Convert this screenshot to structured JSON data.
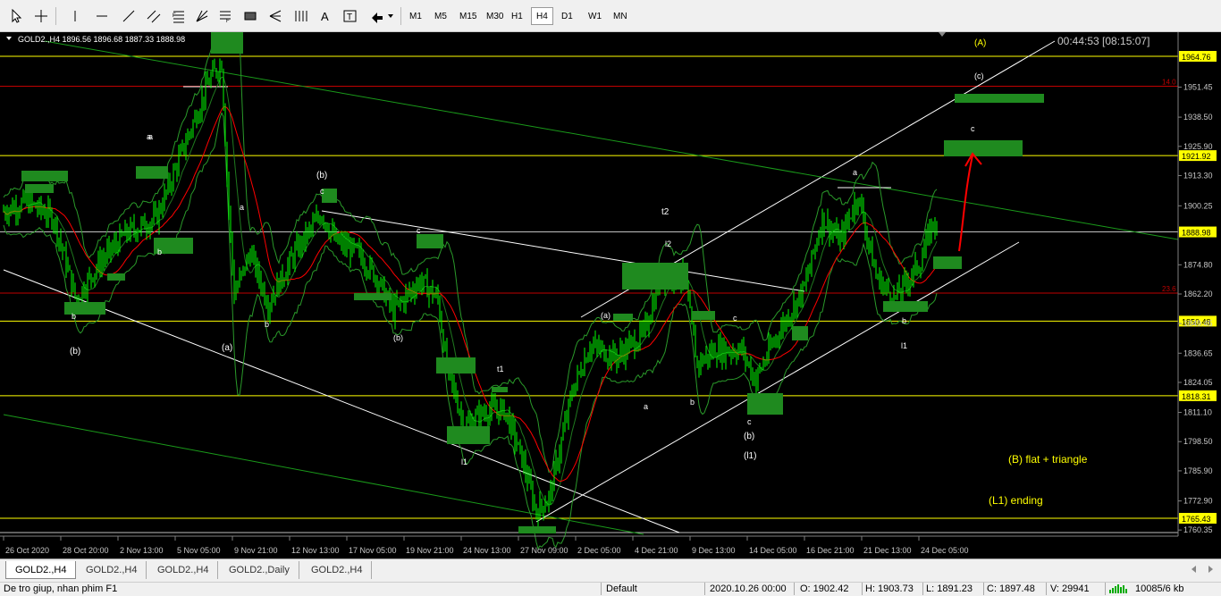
{
  "toolbar": {
    "tools": [
      "cursor-icon",
      "crosshair-icon",
      "vertical-line-icon",
      "horizontal-line-icon",
      "trendline-icon",
      "channel-icon",
      "fibonacci-icon",
      "gann-icon",
      "rectangle-icon",
      "pitchfork-icon",
      "fibo-fan-icon",
      "text-icon",
      "text-label-icon",
      "arrow-icon"
    ],
    "timeframes": [
      "M1",
      "M5",
      "M15",
      "M30",
      "H1",
      "H4",
      "D1",
      "W1",
      "MN"
    ],
    "active_timeframe": "H4"
  },
  "chart": {
    "symbol_info": "GOLD2.,H4  1896.56 1896.68 1887.33 1888.98",
    "timer": "00:44:53 [08:15:07]",
    "bg_color": "#000000",
    "candle_color": "#00ff00",
    "ma_red_color": "#ff0000",
    "level_yellow_color": "#ffff00",
    "level_red_color": "#c00000",
    "zone_color": "#1f8a1f",
    "price_axis": [
      "1964.76",
      "1951.45",
      "1938.50",
      "1925.90",
      "1921.92",
      "1913.30",
      "1900.25",
      "1888.98",
      "1874.80",
      "1862.20",
      "1850.48",
      "1849.45",
      "1836.65",
      "1824.05",
      "1818.31",
      "1811.10",
      "1798.50",
      "1785.90",
      "1772.90",
      "1765.43",
      "1760.35"
    ],
    "highlight_prices": [
      "1964.76",
      "1921.92",
      "1888.98",
      "1850.48",
      "1818.31",
      "1765.43"
    ],
    "time_axis": [
      "26 Oct 2020",
      "28 Oct 20:00",
      "2 Nov 13:00",
      "5 Nov 05:00",
      "9 Nov 21:00",
      "12 Nov 13:00",
      "17 Nov 05:00",
      "19 Nov 21:00",
      "24 Nov 13:00",
      "27 Nov 09:00",
      "2 Dec 05:00",
      "4 Dec 21:00",
      "9 Dec 13:00",
      "14 Dec 05:00",
      "16 Dec 21:00",
      "21 Dec 13:00",
      "24 Dec 05:00"
    ],
    "fib_labels": [
      "14.0",
      "23.6"
    ],
    "wave_labels": [
      "(A)",
      "(c)",
      "c",
      "a",
      "(b)",
      "c",
      "a",
      "b",
      "(a)",
      "c",
      "(b)",
      "t1",
      "l1",
      "t2",
      "l2",
      "(a)",
      "c",
      "a",
      "b",
      "b",
      "a",
      "b",
      "c",
      "(b)",
      "(l1)",
      "a",
      "b",
      "l1"
    ],
    "notes": [
      "(B) flat + triangle",
      "(L1) ending"
    ]
  },
  "tabs": [
    "GOLD2.,H4",
    "GOLD2.,H4",
    "GOLD2.,H4",
    "GOLD2.,Daily",
    "GOLD2.,H4"
  ],
  "status": {
    "help": "De tro giup, nhan phim F1",
    "profile": "Default",
    "datetime": "2020.10.26 00:00",
    "open": "O: 1902.42",
    "high": "H: 1903.73",
    "low": "L: 1891.23",
    "close": "C: 1897.48",
    "volume": "V: 29941",
    "traffic": "10085/6 kb"
  }
}
